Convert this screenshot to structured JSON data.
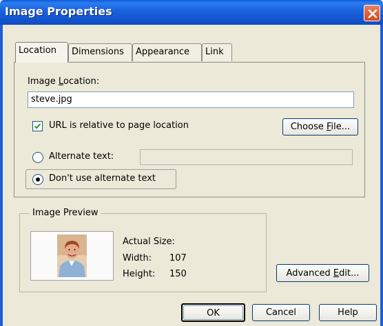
{
  "window": {
    "title": "Image Properties",
    "close_icon": "close-icon",
    "title_gradient": [
      "#0a5bd8",
      "#0f4cc2"
    ]
  },
  "tabs": [
    {
      "label": "Location",
      "active": true
    },
    {
      "label": "Dimensions",
      "active": false
    },
    {
      "label": "Appearance",
      "active": false
    },
    {
      "label": "Link",
      "active": false
    }
  ],
  "location": {
    "image_location_label_pre": "Image ",
    "image_location_label_key": "L",
    "image_location_label_post": "ocation:",
    "image_location_value": "steve.jpg",
    "relative_checkbox_label": "URL is relative to page location",
    "relative_checked": true,
    "choose_file_pre": "Choose ",
    "choose_file_key": "F",
    "choose_file_post": "ile...",
    "alternate_text_label": "Alternate text:",
    "alternate_text_value": "",
    "no_alt_label": "Don't use alternate text",
    "selected_option": "no_alt"
  },
  "preview": {
    "group_title": "Image Preview",
    "actual_size_label": "Actual Size:",
    "width_label": "Width:",
    "width_value": "107",
    "height_label": "Height:",
    "height_value": "150"
  },
  "buttons": {
    "advanced_edit_pre": "Advanced ",
    "advanced_edit_key": "E",
    "advanced_edit_post": "dit...",
    "ok": "OK",
    "cancel": "Cancel",
    "help": "Help"
  }
}
